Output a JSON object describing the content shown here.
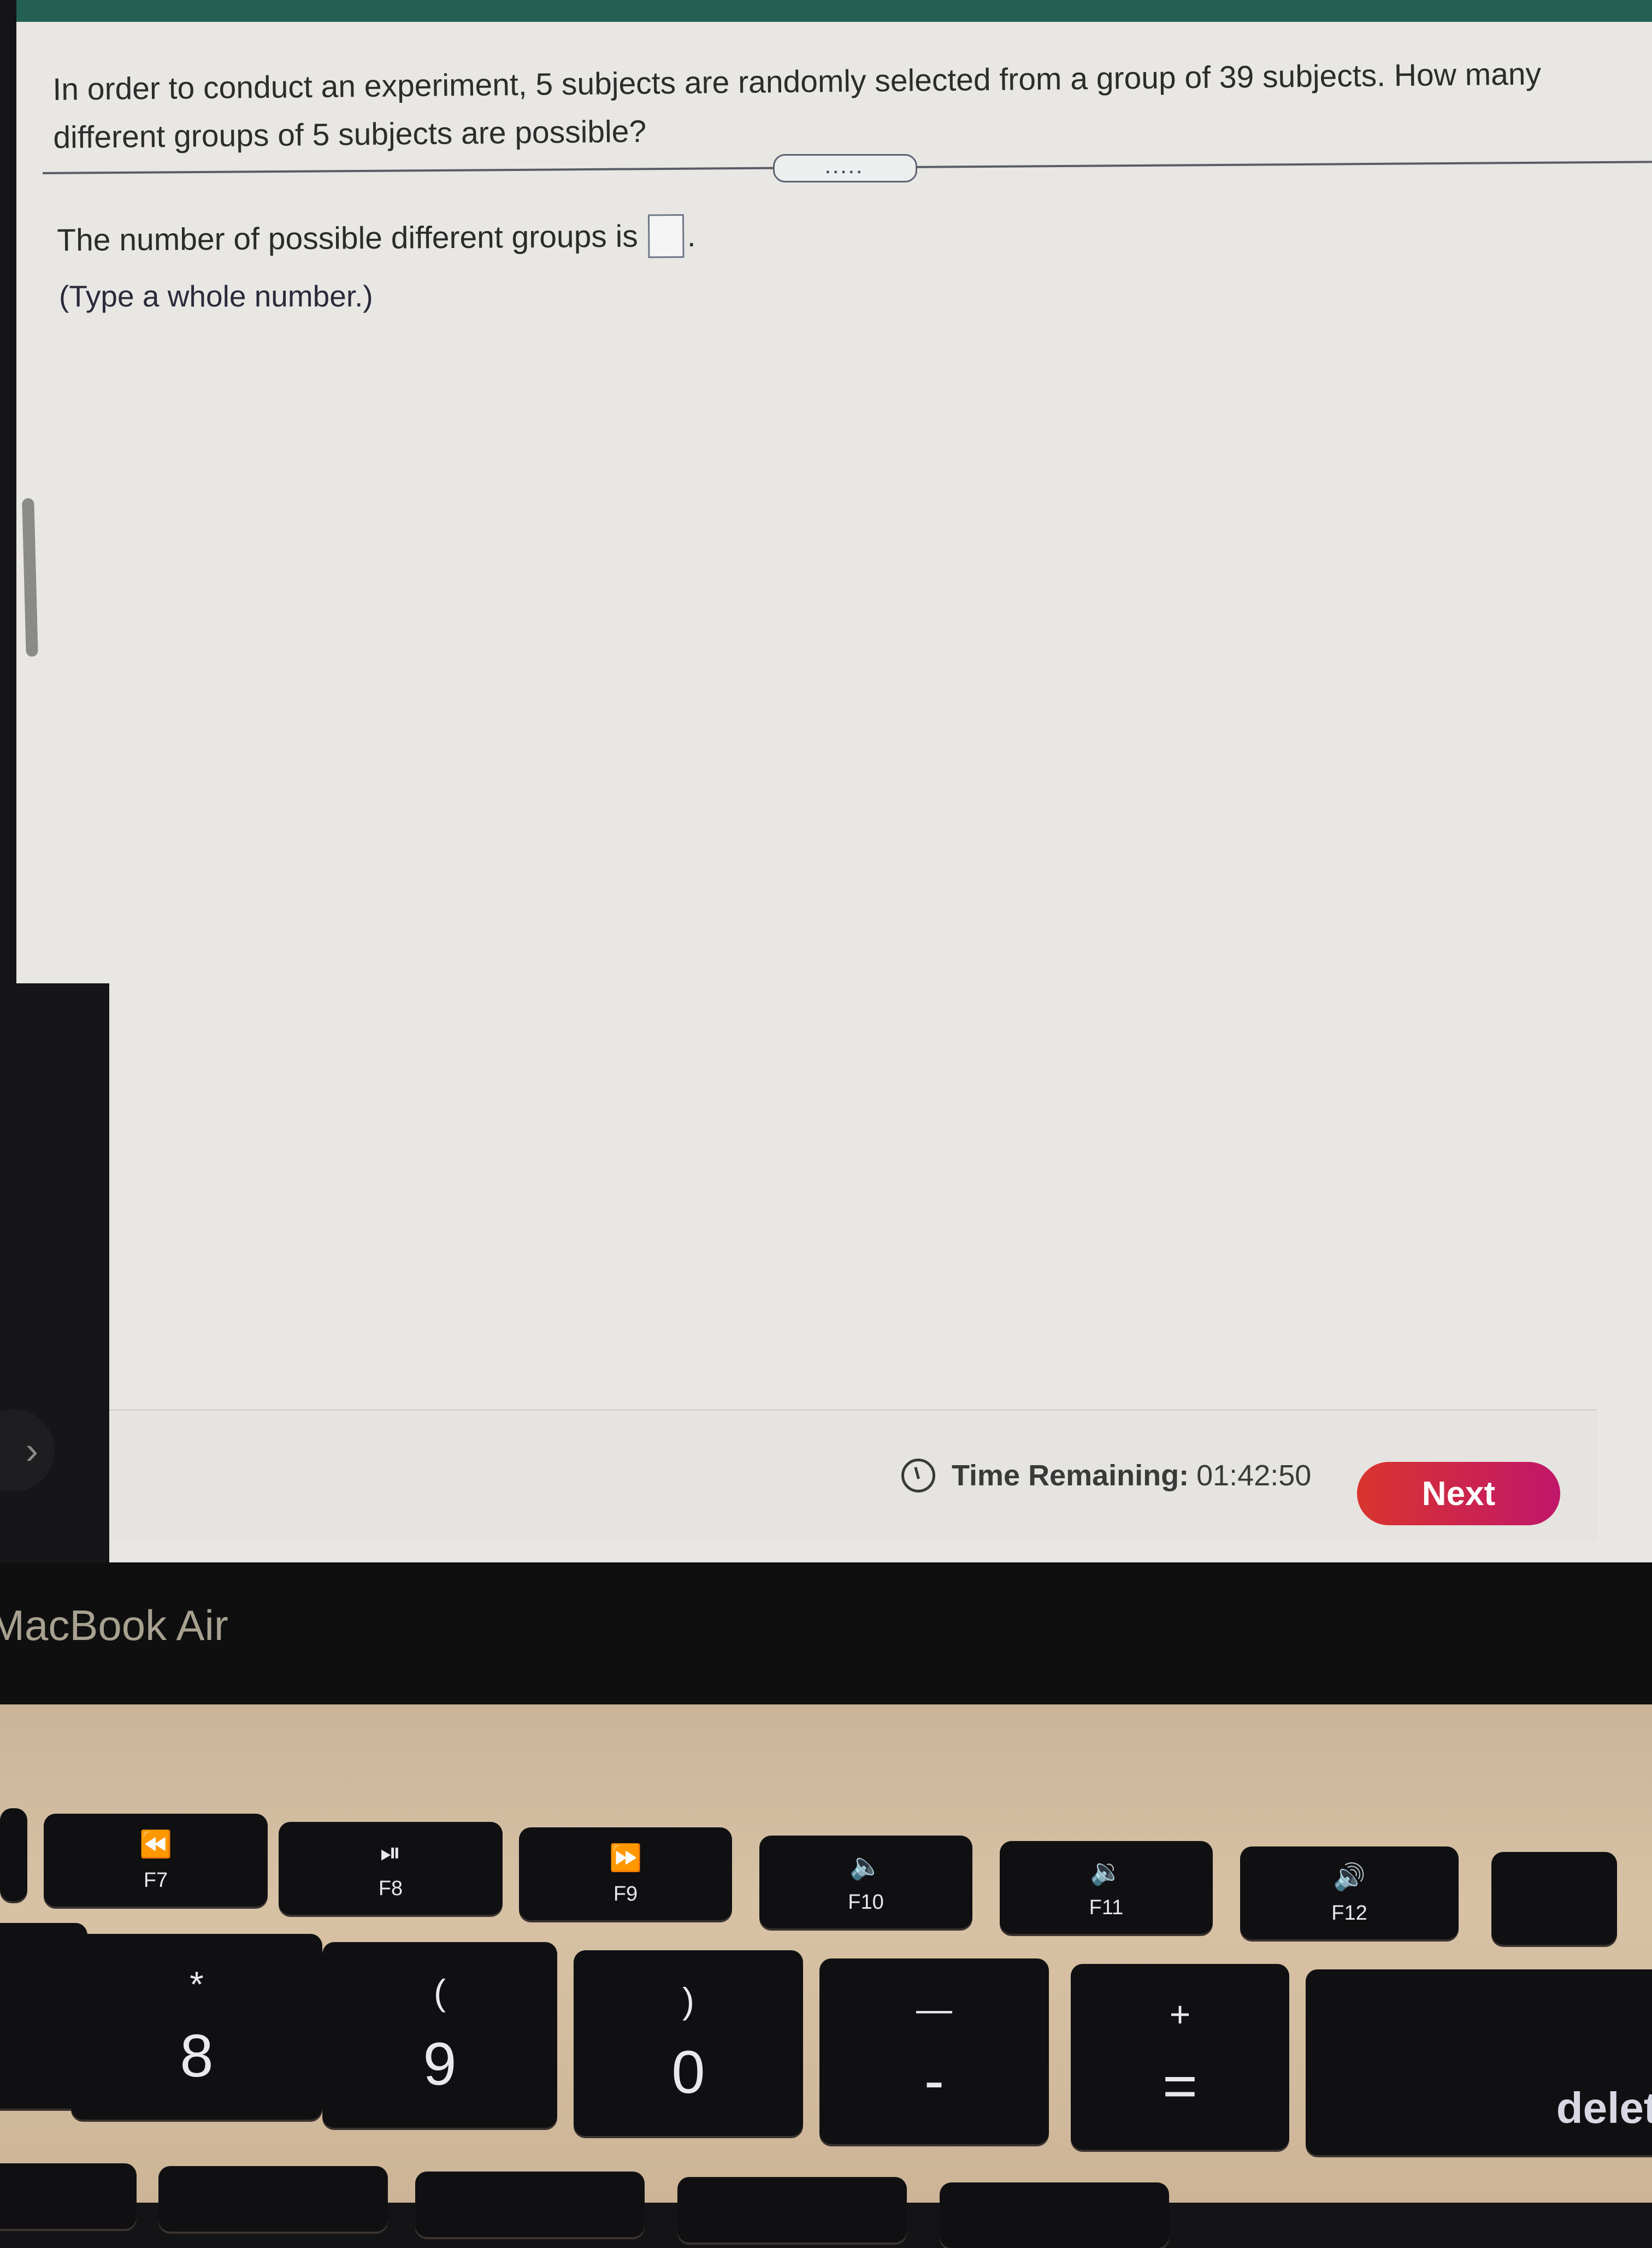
{
  "question": {
    "text": "In order to conduct an experiment, 5 subjects are randomly selected from a group of 39 subjects. How many different groups of 5 subjects are possible?"
  },
  "divider": {
    "handle_icon": "drag-handle-dots",
    "handle_text": "....."
  },
  "answer": {
    "prompt": "The number of possible different groups is",
    "value": "",
    "suffix": ".",
    "hint": "(Type a whole number.)"
  },
  "footer": {
    "timer_icon": "clock-icon",
    "timer_label": "Time Remaining:",
    "timer_value": "01:42:50",
    "next_label": "Next",
    "next_color": "#d0245a"
  },
  "side_nav": {
    "expand_icon": "chevron-right-icon",
    "expand_glyph": "›"
  },
  "device": {
    "brand_label": "MacBook Air"
  },
  "keyboard": {
    "function_keys": [
      {
        "glyph": "⏪",
        "label": "F7"
      },
      {
        "glyph": "⏯",
        "label": "F8"
      },
      {
        "glyph": "⏩",
        "label": "F9"
      },
      {
        "glyph": "🔈",
        "label": "F10"
      },
      {
        "glyph": "🔉",
        "label": "F11"
      },
      {
        "glyph": "🔊",
        "label": "F12"
      }
    ],
    "number_keys": [
      {
        "top": "*",
        "bottom": "8"
      },
      {
        "top": "(",
        "bottom": "9"
      },
      {
        "top": ")",
        "bottom": "0"
      },
      {
        "top": "—",
        "bottom": "-"
      },
      {
        "top": "+",
        "bottom": "="
      }
    ],
    "delete_label": "delete"
  }
}
